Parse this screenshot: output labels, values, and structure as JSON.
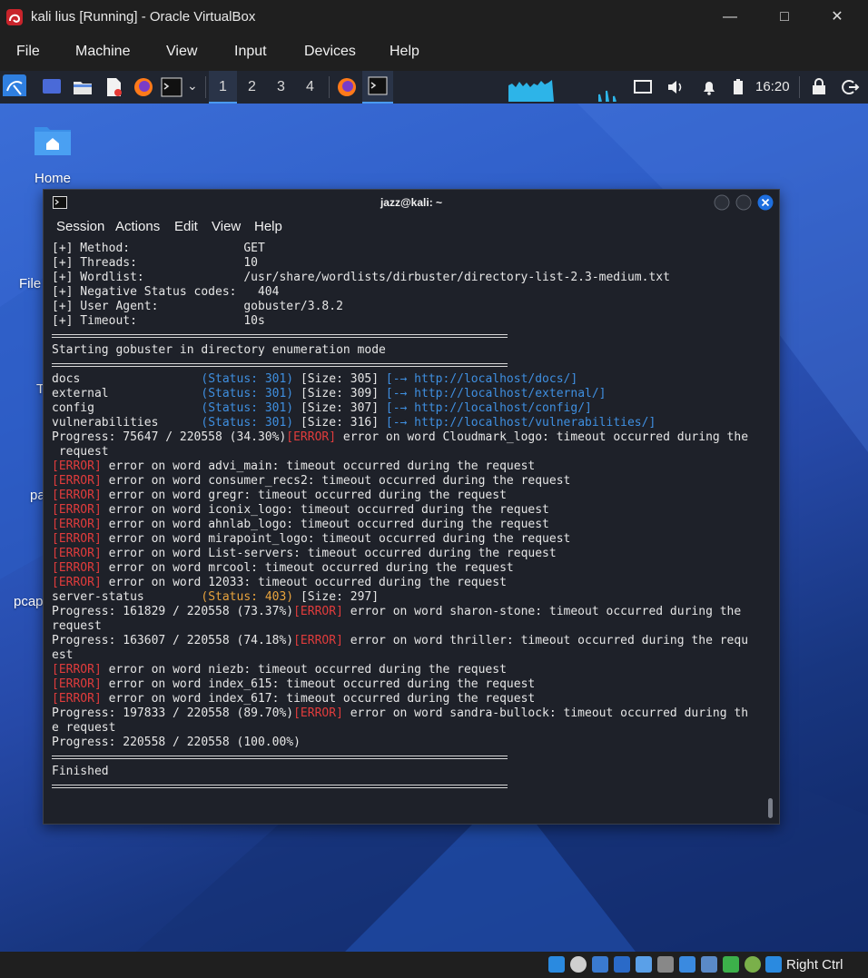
{
  "vbox": {
    "title": "kali lius [Running] - Oracle VirtualBox",
    "menu": [
      "File",
      "Machine",
      "View",
      "Input",
      "Devices",
      "Help"
    ],
    "host_key": "Right Ctrl"
  },
  "panel": {
    "workspaces": [
      "1",
      "2",
      "3",
      "4"
    ],
    "active_workspace": "1",
    "clock": "16:20"
  },
  "desktop": {
    "icons": [
      "Home",
      "File",
      "T",
      "pa",
      "pcap"
    ]
  },
  "terminal": {
    "title": "jazz@kali: ~",
    "menu": [
      "Session",
      "Actions",
      "Edit",
      "View",
      "Help"
    ],
    "lines": [
      [
        {
          "t": "[+] Method:                GET"
        }
      ],
      [
        {
          "t": "[+] Threads:               10"
        }
      ],
      [
        {
          "t": "[+] Wordlist:              /usr/share/wordlists/dirbuster/directory-list-2.3-medium.txt"
        }
      ],
      [
        {
          "t": "[+] Negative Status codes:   404"
        }
      ],
      [
        {
          "t": "[+] User Agent:            gobuster/3.8.2"
        }
      ],
      [
        {
          "t": "[+] Timeout:               10s"
        }
      ],
      "SEP",
      [
        {
          "t": "Starting gobuster in directory enumeration mode"
        }
      ],
      "SEP",
      [
        {
          "t": "docs                 "
        },
        {
          "t": "(Status: 301)",
          "c": "status"
        },
        {
          "t": " [Size: 305] "
        },
        {
          "t": "[-→ http://localhost/docs/]",
          "c": "url"
        }
      ],
      [
        {
          "t": "external             "
        },
        {
          "t": "(Status: 301)",
          "c": "status"
        },
        {
          "t": " [Size: 309] "
        },
        {
          "t": "[-→ http://localhost/external/]",
          "c": "url"
        }
      ],
      [
        {
          "t": "config               "
        },
        {
          "t": "(Status: 301)",
          "c": "status"
        },
        {
          "t": " [Size: 307] "
        },
        {
          "t": "[-→ http://localhost/config/]",
          "c": "url"
        }
      ],
      [
        {
          "t": "vulnerabilities      "
        },
        {
          "t": "(Status: 301)",
          "c": "status"
        },
        {
          "t": " [Size: 316] "
        },
        {
          "t": "[-→ http://localhost/vulnerabilities/]",
          "c": "url"
        }
      ],
      [
        {
          "t": "Progress: 75647 / 220558 (34.30%)"
        },
        {
          "t": "[ERROR]",
          "c": "err"
        },
        {
          "t": " error on word Cloudmark_logo: timeout occurred during the"
        }
      ],
      [
        {
          "t": " request"
        }
      ],
      [
        {
          "t": "[ERROR]",
          "c": "err"
        },
        {
          "t": " error on word advi_main: timeout occurred during the request"
        }
      ],
      [
        {
          "t": "[ERROR]",
          "c": "err"
        },
        {
          "t": " error on word consumer_recs2: timeout occurred during the request"
        }
      ],
      [
        {
          "t": "[ERROR]",
          "c": "err"
        },
        {
          "t": " error on word gregr: timeout occurred during the request"
        }
      ],
      [
        {
          "t": "[ERROR]",
          "c": "err"
        },
        {
          "t": " error on word iconix_logo: timeout occurred during the request"
        }
      ],
      [
        {
          "t": "[ERROR]",
          "c": "err"
        },
        {
          "t": " error on word ahnlab_logo: timeout occurred during the request"
        }
      ],
      [
        {
          "t": "[ERROR]",
          "c": "err"
        },
        {
          "t": " error on word mirapoint_logo: timeout occurred during the request"
        }
      ],
      [
        {
          "t": "[ERROR]",
          "c": "err"
        },
        {
          "t": " error on word List-servers: timeout occurred during the request"
        }
      ],
      [
        {
          "t": "[ERROR]",
          "c": "err"
        },
        {
          "t": " error on word mrcool: timeout occurred during the request"
        }
      ],
      [
        {
          "t": "[ERROR]",
          "c": "err"
        },
        {
          "t": " error on word 12033: timeout occurred during the request"
        }
      ],
      [
        {
          "t": "server-status        "
        },
        {
          "t": "(Status: 403)",
          "c": "status403"
        },
        {
          "t": " [Size: 297]"
        }
      ],
      [
        {
          "t": "Progress: 161829 / 220558 (73.37%)"
        },
        {
          "t": "[ERROR]",
          "c": "err"
        },
        {
          "t": " error on word sharon-stone: timeout occurred during the"
        }
      ],
      [
        {
          "t": "request"
        }
      ],
      [
        {
          "t": "Progress: 163607 / 220558 (74.18%)"
        },
        {
          "t": "[ERROR]",
          "c": "err"
        },
        {
          "t": " error on word thriller: timeout occurred during the requ"
        }
      ],
      [
        {
          "t": "est"
        }
      ],
      [
        {
          "t": "[ERROR]",
          "c": "err"
        },
        {
          "t": " error on word niezb: timeout occurred during the request"
        }
      ],
      [
        {
          "t": "[ERROR]",
          "c": "err"
        },
        {
          "t": " error on word index_615: timeout occurred during the request"
        }
      ],
      [
        {
          "t": "[ERROR]",
          "c": "err"
        },
        {
          "t": " error on word index_617: timeout occurred during the request"
        }
      ],
      [
        {
          "t": "Progress: 197833 / 220558 (89.70%)"
        },
        {
          "t": "[ERROR]",
          "c": "err"
        },
        {
          "t": " error on word sandra-bullock: timeout occurred during th"
        }
      ],
      [
        {
          "t": "e request"
        }
      ],
      [
        {
          "t": "Progress: 220558 / 220558 (100.00%)"
        }
      ],
      "SEP",
      [
        {
          "t": "Finished"
        }
      ],
      "SEP"
    ]
  },
  "colors": {
    "status": "#3f8fe0",
    "status403": "#e8a33d",
    "error": "#e03c3c",
    "terminal_bg": "#1e2129"
  }
}
